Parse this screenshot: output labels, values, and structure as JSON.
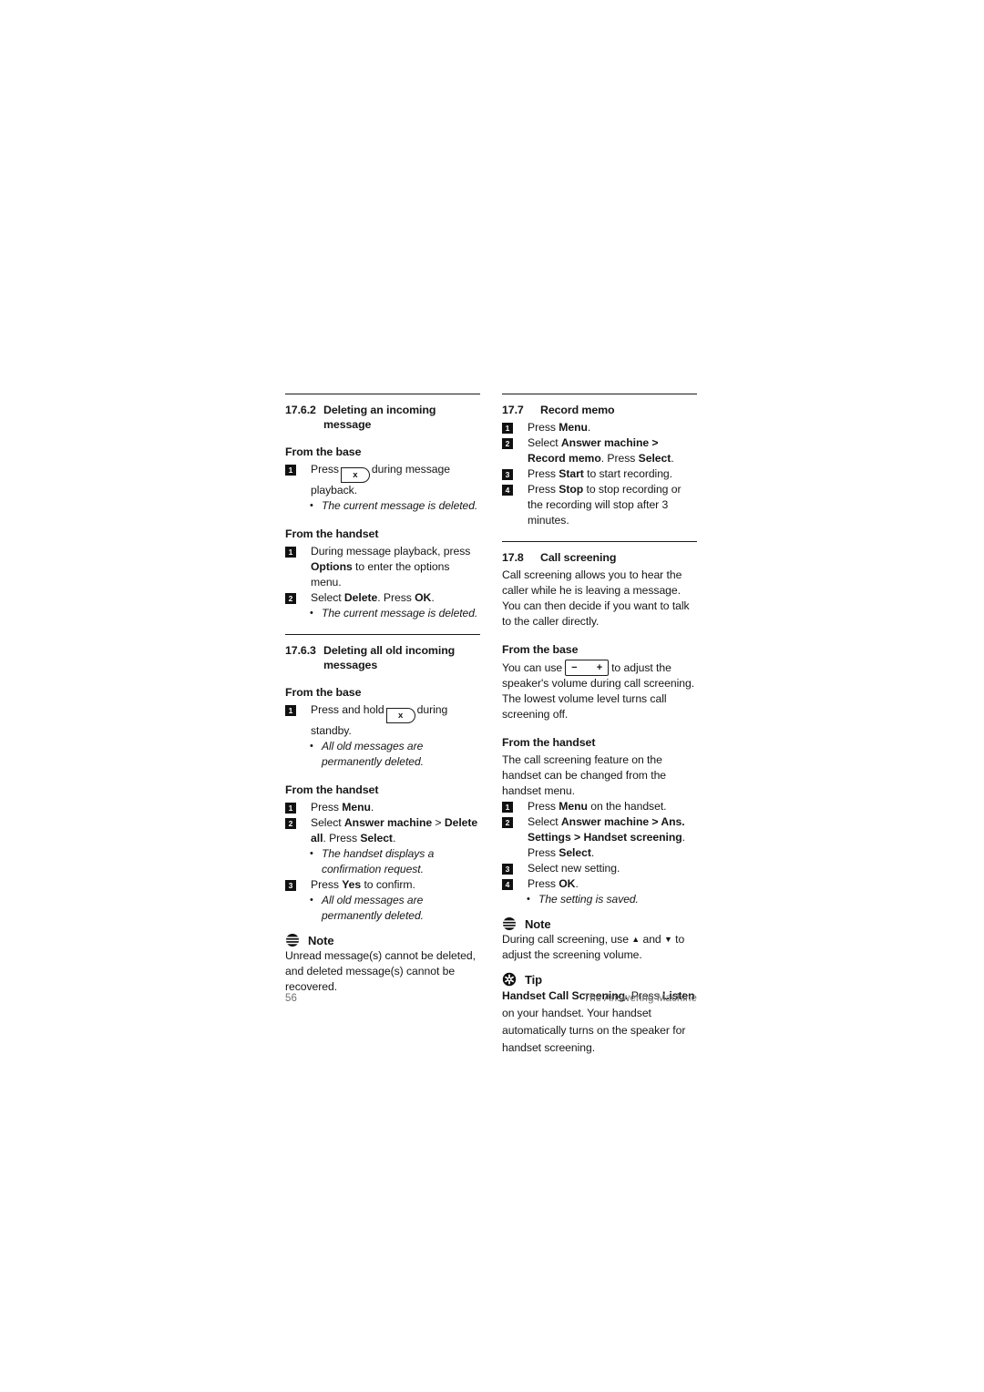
{
  "page": {
    "number": "56",
    "running_title": "The Answering Machine"
  },
  "left_column": {
    "section_1": {
      "number": "17.6.2",
      "title": "Deleting an incoming message",
      "sub_base": {
        "heading": "From the base",
        "steps": [
          {
            "num": "1",
            "pre": "Press",
            "key": "x",
            "post": "during message playback."
          }
        ],
        "bullets": [
          "The current message is deleted."
        ]
      },
      "sub_handset": {
        "heading": "From the handset",
        "steps": [
          {
            "num": "1",
            "text_parts": [
              "During message playback, press ",
              "Options",
              " to enter the options menu."
            ]
          },
          {
            "num": "2",
            "text_parts": [
              "Select ",
              "Delete",
              ". Press ",
              "OK",
              "."
            ]
          }
        ],
        "bullets": [
          "The current message is deleted."
        ]
      }
    },
    "section_2": {
      "number": "17.6.3",
      "title": "Deleting all old incoming messages",
      "sub_base": {
        "heading": "From the base",
        "steps": [
          {
            "num": "1",
            "pre": "Press and hold",
            "key": "x",
            "post": "during standby."
          }
        ],
        "bullets": [
          "All old messages are permanently deleted."
        ]
      },
      "sub_handset": {
        "heading": "From the handset",
        "steps": [
          {
            "num": "1",
            "text_parts": [
              "Press ",
              "Menu",
              "."
            ]
          },
          {
            "num": "2",
            "text_parts": [
              "Select ",
              "Answer machine",
              " > ",
              "Delete all",
              ". Press ",
              "Select",
              "."
            ]
          }
        ],
        "bullet_mid": "The handset displays a confirmation request.",
        "step_3": {
          "num": "3",
          "text_parts": [
            "Press ",
            "Yes",
            " to confirm."
          ]
        },
        "bullet_end": "All old messages are permanently deleted."
      },
      "note": {
        "icon": "note-icon",
        "label": "Note",
        "body": "Unread message(s) cannot be deleted, and deleted message(s) cannot be recovered."
      }
    }
  },
  "right_column": {
    "section_3": {
      "number": "17.7",
      "title": "Record memo",
      "steps": [
        {
          "num": "1",
          "text_parts": [
            "Press ",
            "Menu",
            "."
          ]
        },
        {
          "num": "2",
          "text_parts": [
            "Select ",
            "Answer machine",
            " > ",
            "Record memo",
            ". Press ",
            "Select",
            "."
          ]
        },
        {
          "num": "3",
          "text_parts": [
            "Press ",
            "Start",
            " to start recording."
          ]
        },
        {
          "num": "4",
          "text_parts": [
            "Press ",
            "Stop",
            " to stop recording or the recording will stop after 3 minutes."
          ]
        }
      ]
    },
    "section_4": {
      "number": "17.8",
      "title": "Call screening",
      "intro": "Call screening allows you to hear the caller while he is leaving a message. You can then decide if you want to talk to the caller directly.",
      "sub_base": {
        "heading": "From the base",
        "pre": "You can use",
        "key_minus": "−",
        "key_plus": "+",
        "post": "to adjust the speaker's volume during call screening. The lowest volume level turns call screening off."
      },
      "sub_handset": {
        "heading": "From the handset",
        "intro": "The call screening feature on the handset can be changed from the handset menu.",
        "steps": [
          {
            "num": "1",
            "text_parts": [
              "Press ",
              "Menu",
              " on the handset."
            ]
          },
          {
            "num": "2",
            "text_parts": [
              "Select ",
              "Answer machine",
              " > ",
              "Ans. Settings",
              " > ",
              "Handset screening",
              ". Press ",
              "Select",
              "."
            ]
          },
          {
            "num": "3",
            "text_parts": [
              "Select new setting."
            ]
          },
          {
            "num": "4",
            "text_parts": [
              "Press ",
              "OK",
              "."
            ]
          }
        ],
        "bullets": [
          "The setting is saved."
        ]
      },
      "note": {
        "icon": "note-icon",
        "label": "Note",
        "body_pre": "During call screening, use ",
        "arrow_up": "▲",
        "body_mid": " and ",
        "arrow_down": "▼",
        "body_post": " to adjust the screening volume."
      },
      "tip": {
        "icon": "tip-icon",
        "label": "Tip",
        "bold_lead": "Handset Call Screening.",
        "body_parts": [
          " Press ",
          "Listen",
          " on your handset. Your handset automatically turns on the speaker for handset screening."
        ]
      }
    }
  }
}
